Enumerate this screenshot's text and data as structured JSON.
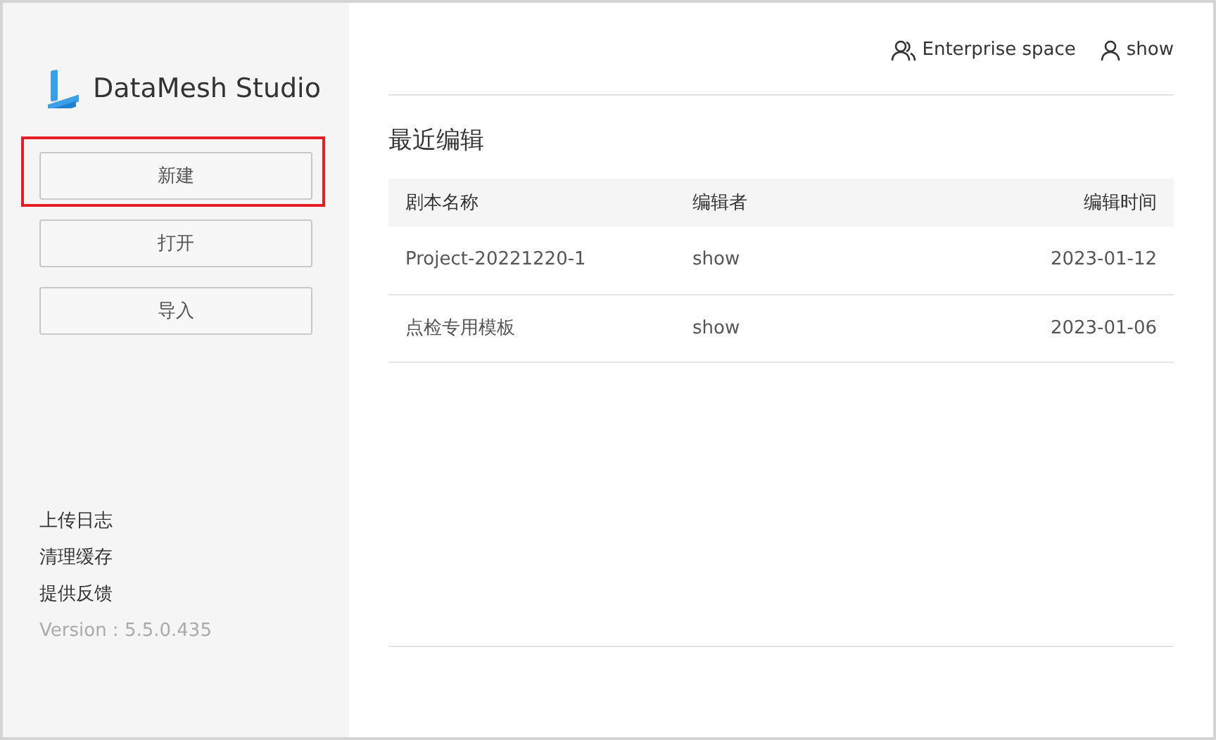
{
  "sidebar": {
    "app_name": "DataMesh Studio",
    "buttons": [
      {
        "label": "新建",
        "highlighted": true
      },
      {
        "label": "打开",
        "highlighted": false
      },
      {
        "label": "导入",
        "highlighted": false
      }
    ],
    "links": [
      "上传日志",
      "清理缓存",
      "提供反馈"
    ],
    "version": "Version : 5.5.0.435"
  },
  "header": {
    "workspace": "Enterprise space",
    "user": "show"
  },
  "recent": {
    "title": "最近编辑",
    "columns": [
      "剧本名称",
      "编辑者",
      "编辑时间"
    ],
    "rows": [
      [
        "Project-20221220-1",
        "show",
        "2023-01-12"
      ],
      [
        "点检专用模板",
        "show",
        "2023-01-06"
      ]
    ]
  }
}
